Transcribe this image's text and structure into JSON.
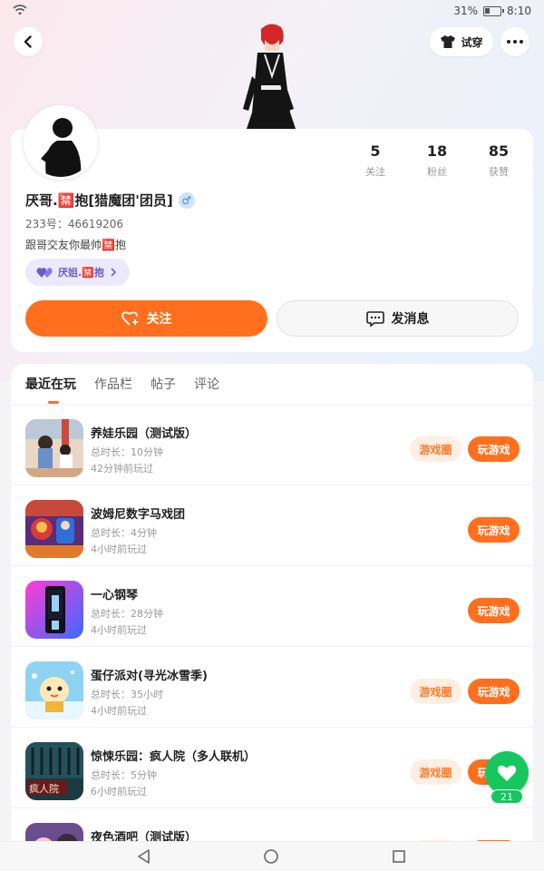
{
  "status_bar": {
    "battery": "31%",
    "time": "8:10"
  },
  "header": {
    "try_on_label": "试穿"
  },
  "profile": {
    "stats": [
      {
        "value": "5",
        "label": "关注"
      },
      {
        "value": "18",
        "label": "粉丝"
      },
      {
        "value": "85",
        "label": "获赞"
      }
    ],
    "nickname": "厌哥.🈲抱[猎魔团'团员]",
    "gender_symbol": "♂",
    "uid": "233号：46619206",
    "bio": "跟哥交友你最帅🈲抱",
    "couple_tag": "厌姐.🈲抱",
    "follow_label": "关注",
    "message_label": "发消息"
  },
  "tabs": [
    {
      "label": "最近在玩",
      "active": true
    },
    {
      "label": "作品栏",
      "active": false
    },
    {
      "label": "帖子",
      "active": false
    },
    {
      "label": "评论",
      "active": false
    }
  ],
  "games": [
    {
      "name": "养娃乐园（测试版）",
      "duration": "总时长：10分钟",
      "last_played": "42分钟前玩过",
      "circle_label": "游戏圈",
      "play_label": "玩游戏"
    },
    {
      "name": "波姆尼数字马戏团",
      "duration": "总时长：4分钟",
      "last_played": "4小时前玩过",
      "play_label": "玩游戏"
    },
    {
      "name": "一心钢琴",
      "duration": "总时长：28分钟",
      "last_played": "4小时前玩过",
      "play_label": "玩游戏"
    },
    {
      "name": "蛋仔派对(寻光冰雪季)",
      "duration": "总时长：35小时",
      "last_played": "4小时前玩过",
      "circle_label": "游戏圈",
      "play_label": "玩游戏"
    },
    {
      "name": "惊悚乐园：疯人院（多人联机）",
      "duration": "总时长：5分钟",
      "last_played": "6小时前玩过",
      "circle_label": "游戏圈",
      "play_label": "玩游戏"
    },
    {
      "name": "夜色酒吧（测试版）"
    }
  ],
  "game_icon_texts": {
    "asylum": "疯人院"
  },
  "like_fab": {
    "count": "21"
  },
  "colors": {
    "accent": "#ff6f1d",
    "like_green": "#16c75e",
    "couple_purple": "#6d5cc8"
  }
}
